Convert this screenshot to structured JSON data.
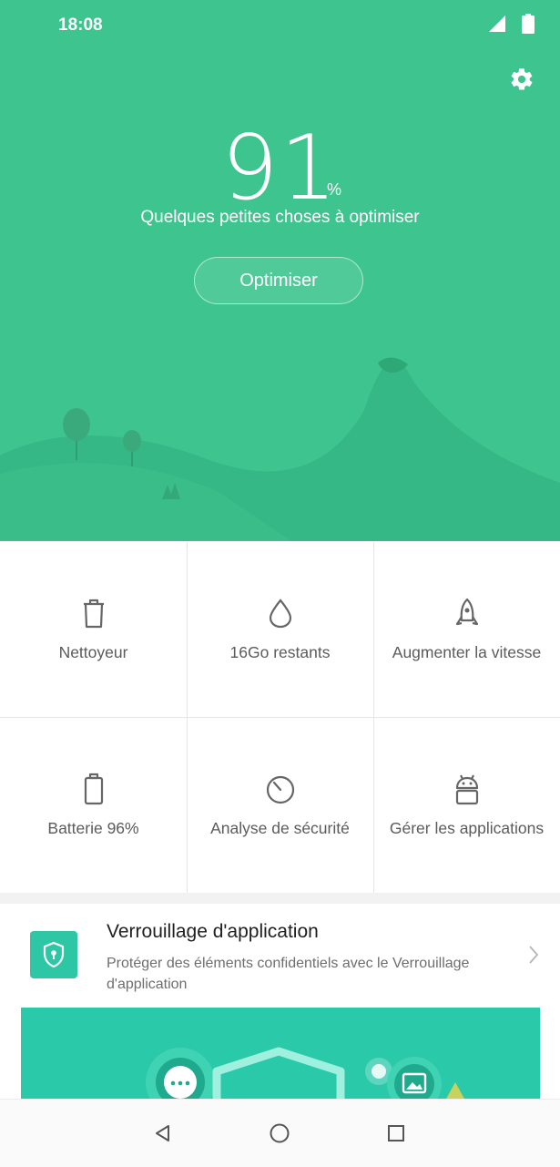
{
  "status_bar": {
    "time": "18:08",
    "icons": [
      "signal-icon",
      "battery-icon"
    ]
  },
  "header": {
    "settings_icon": "gear-icon"
  },
  "score": {
    "value": "91",
    "unit": "%",
    "message": "Quelques petites choses à optimiser"
  },
  "optimize_button": {
    "label": "Optimiser"
  },
  "tools": [
    {
      "label": "Nettoyeur",
      "icon": "trash-icon"
    },
    {
      "label": "16Go restants",
      "icon": "drop-icon"
    },
    {
      "label": "Augmenter la vitesse",
      "icon": "rocket-icon"
    },
    {
      "label": "Batterie 96%",
      "icon": "battery-outline-icon"
    },
    {
      "label": "Analyse de sécurité",
      "icon": "timer-icon"
    },
    {
      "label": "Gérer les applications",
      "icon": "android-icon"
    }
  ],
  "app_lock_card": {
    "title": "Verrouillage d'application",
    "description": "Protéger des éléments confidentiels avec le Verrouillage d'application",
    "icon": "shield-lock-icon"
  },
  "nav_bar": {
    "buttons": [
      "back-icon",
      "home-icon",
      "recents-icon"
    ]
  },
  "colors": {
    "hero": "#3ec48f",
    "accent": "#2ec7a5",
    "banner": "#29c9aa"
  }
}
